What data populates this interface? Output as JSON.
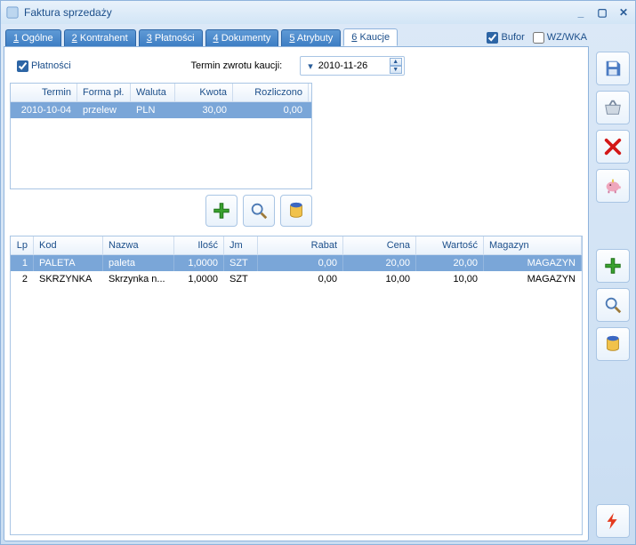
{
  "window_title": "Faktura sprzedaży",
  "tabs": [
    {
      "num": "1",
      "label": "Ogólne"
    },
    {
      "num": "2",
      "label": "Kontrahent"
    },
    {
      "num": "3",
      "label": "Płatności"
    },
    {
      "num": "4",
      "label": "Dokumenty"
    },
    {
      "num": "5",
      "label": "Atrybuty"
    },
    {
      "num": "6",
      "label": "Kaucje"
    }
  ],
  "active_tab": 5,
  "bufor_label": "Bufor",
  "wzwka_label": "WZ/WKA",
  "platnosci_checkbox": "Płatności",
  "termin_label": "Termin zwrotu kaucji:",
  "termin_value": "2010-11-26",
  "pay_grid": {
    "headers": [
      "Termin",
      "Forma pł.",
      "Waluta",
      "Kwota",
      "Rozliczono"
    ],
    "row": [
      "2010-10-04",
      "przelew",
      "PLN",
      "30,00",
      "0,00"
    ]
  },
  "item_grid": {
    "headers": [
      "Lp",
      "Kod",
      "Nazwa",
      "Ilość",
      "Jm",
      "Rabat",
      "Cena",
      "Wartość",
      "Magazyn"
    ],
    "rows": [
      {
        "lp": "1",
        "kod": "PALETA",
        "nazwa": "paleta",
        "ilosc": "1,0000",
        "jm": "SZT",
        "rabat": "0,00",
        "cena": "20,00",
        "wart": "20,00",
        "mag": "MAGAZYN"
      },
      {
        "lp": "2",
        "kod": "SKRZYNKA",
        "nazwa": "Skrzynka n...",
        "ilosc": "1,0000",
        "jm": "SZT",
        "rabat": "0,00",
        "cena": "10,00",
        "wart": "10,00",
        "mag": "MAGAZYN"
      }
    ]
  },
  "icons": {
    "save": "save-icon",
    "basket": "basket-icon",
    "delete": "delete-icon",
    "piggy": "piggy-icon",
    "plus": "plus-icon",
    "search": "search-icon",
    "barrel": "barrel-icon",
    "bolt": "bolt-icon"
  }
}
